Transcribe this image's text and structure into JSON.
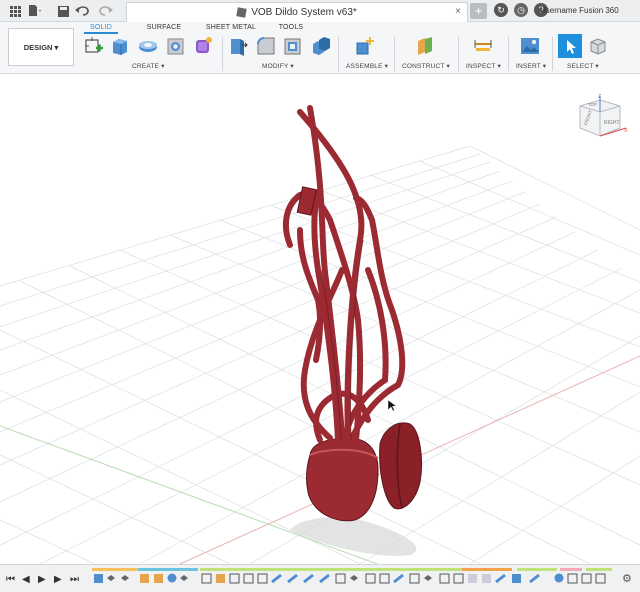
{
  "topbar": {
    "grid_icon": "grid-icon",
    "file_icon": "file-icon",
    "save_icon": "save-icon",
    "undo_icon": "undo-icon",
    "redo_icon": "redo-icon",
    "doc_title": "VOB Dildo System v63*",
    "close_glyph": "×",
    "plus_glyph": "+",
    "username": "Username Fusion 360"
  },
  "ribbon": {
    "workspace_label": "DESIGN ▾",
    "tabs": [
      "SOLID",
      "SURFACE",
      "SHEET METAL",
      "TOOLS"
    ],
    "active_tab": "SOLID",
    "groups": {
      "create": "CREATE ▾",
      "modify": "MODIFY ▾",
      "assemble": "ASSEMBLE ▾",
      "construct": "CONSTRUCT ▾",
      "inspect": "INSPECT ▾",
      "insert": "INSERT ▾",
      "select": "SELECT ▾"
    }
  },
  "viewcube": {
    "top": "TOP",
    "front": "FRONT",
    "right": "RIGHT",
    "axis_x": "X",
    "axis_z": "Z"
  },
  "timeline": {
    "first": "⏮",
    "prev": "◀",
    "play": "▶",
    "next": "▶",
    "last": "⏭",
    "gear": "⚙"
  },
  "colors": {
    "accent": "#2a8ad4",
    "model": "#9c2a33",
    "model_dark": "#6e1a22",
    "grid": "#d9dcdf"
  }
}
